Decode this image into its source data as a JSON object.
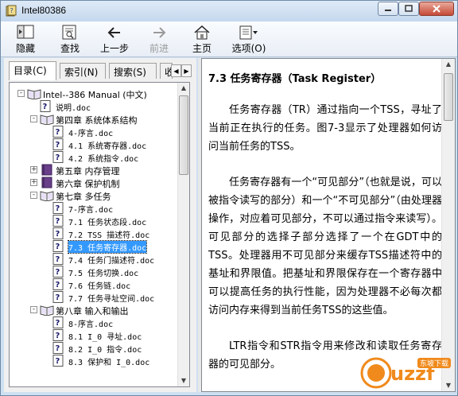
{
  "window": {
    "title": "Intel80386"
  },
  "toolbar": {
    "buttons": [
      {
        "label": "隐藏"
      },
      {
        "label": "查找"
      },
      {
        "label": "上一步"
      },
      {
        "label": "前进"
      },
      {
        "label": "主页"
      },
      {
        "label": "选项(O)"
      }
    ]
  },
  "tabs": [
    {
      "label": "目录(C)"
    },
    {
      "label": "索引(N)"
    },
    {
      "label": "搜索(S)"
    },
    {
      "label": "收"
    }
  ],
  "tree": [
    {
      "label": "Intel--386 Manual (中文)"
    },
    {
      "label": "说明.doc"
    },
    {
      "label": "第四章 系统体系结构"
    },
    {
      "label": "4-序言.doc"
    },
    {
      "label": "4.1 系统寄存器.doc"
    },
    {
      "label": "4.2 系统指令.doc"
    },
    {
      "label": "第五章 内存管理"
    },
    {
      "label": "第六章 保护机制"
    },
    {
      "label": "第七章 多任务"
    },
    {
      "label": "7-序言.doc"
    },
    {
      "label": "7.1 任务状态段.doc"
    },
    {
      "label": "7.2 TSS 描述符.doc"
    },
    {
      "label": "7.3 任务寄存器.doc"
    },
    {
      "label": "7.4 任务门描述符.doc"
    },
    {
      "label": "7.5 任务切换.doc"
    },
    {
      "label": "7.6 任务链.doc"
    },
    {
      "label": "7.7 任务寻址空间.doc"
    },
    {
      "label": "第八章 输入和输出"
    },
    {
      "label": "8-序言.doc"
    },
    {
      "label": "8.1 I_0 寻址.doc"
    },
    {
      "label": "8.2 I_0 指令.doc"
    },
    {
      "label": "8.3 保护和 I_0.doc"
    }
  ],
  "document": {
    "heading": "7.3 任务寄存器（Task Register）",
    "paragraphs": [
      "任务寄存器（TR）通过指向一个TSS，寻址了当前正在执行的任务。图7-3显示了处理器如何访问当前任务的TSS。",
      "任务寄存器有一个“可见部分”（也就是说，可以被指令读写的部分）和一个“不可见部分”（由处理器操作，对应着可见部分，不可以通过指令来读写）。可见部分的选择子部分选择了一个在GDT中的TSS。处理器用不可见部分来缓存TSS描述符中的基址和界限值。把基址和界限保存在一个寄存器中可以提高任务的执行性能，因为处理器不必每次都访问内存来得到当前任务TSS的这些值。",
      "LTR指令和STR指令用来修改和读取任务寄存器的可见部分。"
    ]
  },
  "watermark": {
    "text": "uzzf",
    "sub": "东坡下载"
  },
  "colors": {
    "selection": "#3399ff",
    "titlebar": "#c4d8ee",
    "close": "#c54a37"
  }
}
